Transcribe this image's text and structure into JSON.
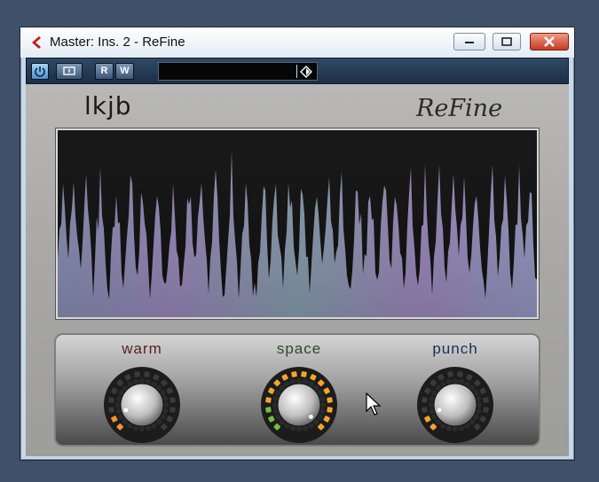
{
  "window": {
    "title": "Master: Ins. 2 - ReFine",
    "buttons": [
      "minimize",
      "maximize",
      "close"
    ]
  },
  "toolbar": {
    "power_icon": "power-icon",
    "bypass_icon": "bypass-icon",
    "read_label": "R",
    "write_label": "W",
    "preset_value": "",
    "preset_arrow_icon": "diamond-arrow-icon"
  },
  "plugin": {
    "preset_name": "lkjb",
    "brand": "ReFine",
    "knobs": [
      {
        "id": "warm",
        "label": "warm",
        "label_color": "#5a1f1f",
        "ring_color": "#c8274a",
        "accent_color": "#f0942d",
        "level": 0.1
      },
      {
        "id": "space",
        "label": "space",
        "label_color": "#2a4a2c",
        "ring_color": "#f3a52a",
        "accent_color": "#6fc33a",
        "level": 1.0
      },
      {
        "id": "punch",
        "label": "punch",
        "label_color": "#1d2f52",
        "ring_color": "#2f78d8",
        "accent_color": "#f3a52a",
        "level": 0.1
      }
    ]
  }
}
